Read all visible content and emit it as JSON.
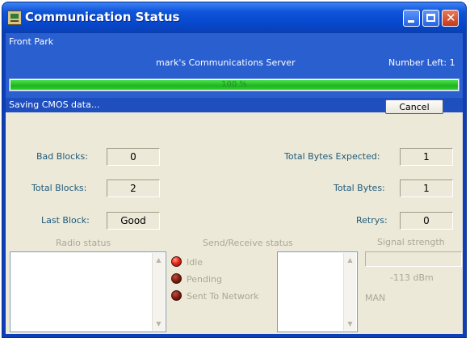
{
  "window": {
    "title": "Communication Status",
    "icon": "app-icon",
    "controls": [
      "minimize-icon",
      "maximize-icon",
      "close-icon"
    ]
  },
  "header": {
    "location": "Front Park",
    "server": "mark's Communications Server",
    "number_left": "Number Left: 1",
    "progress_percent": 100,
    "progress_label": "100 %",
    "status_message": "Saving CMOS data...",
    "cancel_label": "Cancel"
  },
  "stats": {
    "bad_blocks_label": "Bad Blocks:",
    "bad_blocks": "0",
    "total_blocks_label": "Total Blocks:",
    "total_blocks": "2",
    "last_block_label": "Last Block:",
    "last_block": "Good",
    "total_bytes_expected_label": "Total Bytes Expected:",
    "total_bytes_expected": "1",
    "total_bytes_label": "Total Bytes:",
    "total_bytes": "1",
    "retrys_label": "Retrys:",
    "retrys": "0"
  },
  "radio_status": {
    "title": "Radio status"
  },
  "send_receive": {
    "title": "Send/Receive status",
    "indicators": [
      {
        "label": "Idle",
        "state": "on"
      },
      {
        "label": "Pending",
        "state": "off"
      },
      {
        "label": "Sent To Network",
        "state": "off"
      }
    ]
  },
  "signal": {
    "title": "Signal strength",
    "dbm": "-113 dBm",
    "mode": "MAN"
  },
  "colors": {
    "title_bar": "#0747cd",
    "header_panel": "#2a5fd0",
    "progress_green": "#1fb41f",
    "label_teal": "#1f5a7a",
    "led_red": "#e52a1a"
  }
}
